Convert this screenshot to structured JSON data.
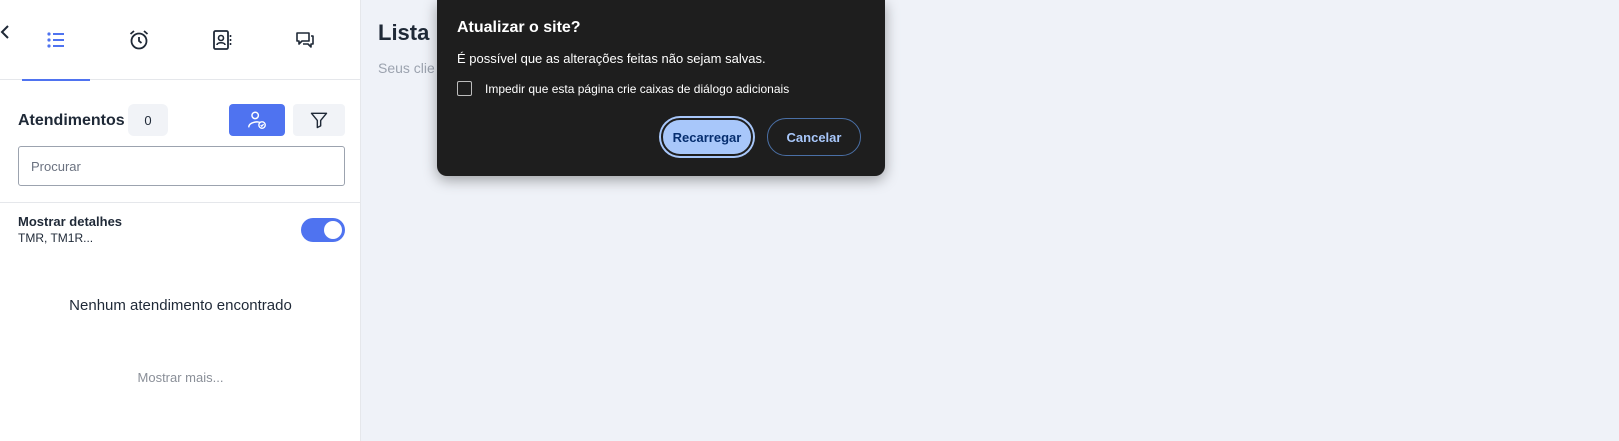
{
  "sidebar": {
    "tabs": [
      {
        "icon": "list-icon",
        "active": true
      },
      {
        "icon": "alarm-clock-icon",
        "active": false
      },
      {
        "icon": "contact-book-icon",
        "active": false
      },
      {
        "icon": "chat-bubbles-icon",
        "active": false
      }
    ],
    "section_title": "Atendimentos",
    "count": "0",
    "search_placeholder": "Procurar",
    "details": {
      "title": "Mostrar detalhes",
      "subtitle": "TMR, TM1R...",
      "enabled": true
    },
    "empty_message": "Nenhum atendimento encontrado",
    "show_more": "Mostrar mais..."
  },
  "main": {
    "title": "Lista",
    "subtitle": "Seus clie"
  },
  "dialog": {
    "title": "Atualizar o site?",
    "message": "É possível que as alterações feitas não sejam salvas.",
    "checkbox_label": "Impedir que esta página crie caixas de diálogo adicionais",
    "checked": false,
    "reload_label": "Recarregar",
    "cancel_label": "Cancelar"
  },
  "colors": {
    "accent": "#4f73f0",
    "dialog_bg": "#1e1e1e",
    "dialog_primary": "#a8c7fa",
    "background": "#eff2f8"
  }
}
